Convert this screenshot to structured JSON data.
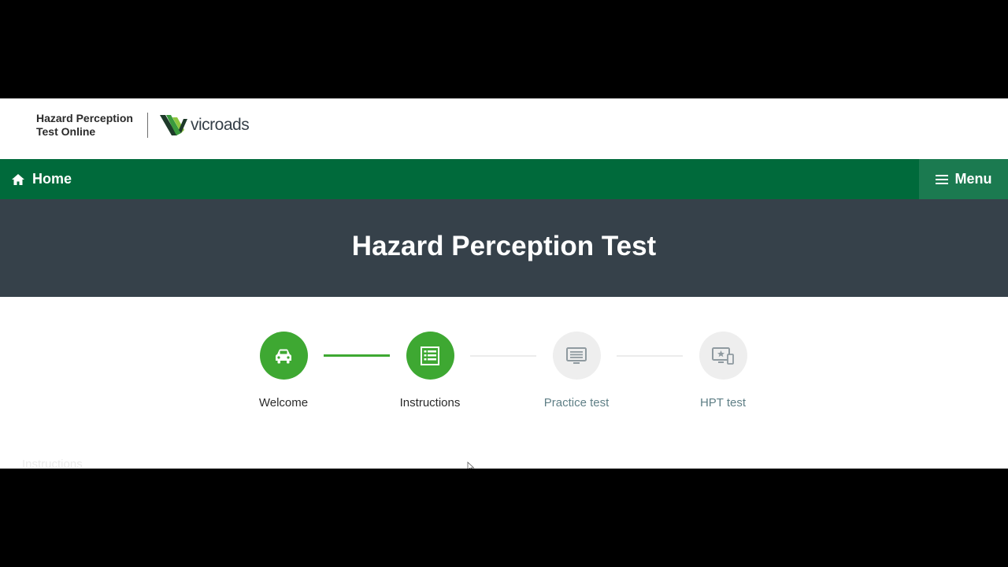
{
  "header": {
    "site_title_line1": "Hazard Perception",
    "site_title_line2": "Test Online",
    "brand_name": "vicroads",
    "brand_colors": {
      "dark": "#1e3a2a",
      "green": "#3a9a3e",
      "light_green": "#8cc63f"
    }
  },
  "nav": {
    "home_label": "Home",
    "home_icon": "home-icon",
    "menu_label": "Menu",
    "menu_icon": "hamburger-icon",
    "bg_color": "#006a3b"
  },
  "hero": {
    "title": "Hazard Perception Test",
    "bg_color": "#36414a"
  },
  "stepper": {
    "steps": [
      {
        "label": "Welcome",
        "icon": "car-icon",
        "status": "done"
      },
      {
        "label": "Instructions",
        "icon": "list-icon",
        "status": "done"
      },
      {
        "label": "Practice test",
        "icon": "monitor-icon",
        "status": "todo"
      },
      {
        "label": "HPT test",
        "icon": "devices-star-icon",
        "status": "todo"
      }
    ],
    "done_color": "#3ea832",
    "todo_color": "#eeeeee"
  },
  "content": {
    "section_label": "Instructions"
  }
}
